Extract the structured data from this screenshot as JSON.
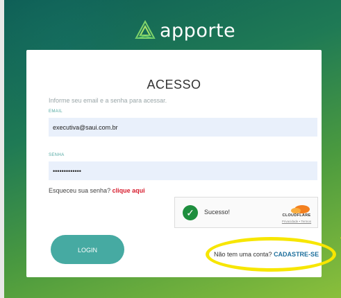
{
  "brand": {
    "name": "apporte"
  },
  "login": {
    "title": "ACESSO",
    "subtitle": "Informe seu email e a senha para acessar.",
    "email_label": "EMAIL",
    "email_value": "executiva@saui.com.br",
    "password_label": "SENHA",
    "password_value": "•••••••••••••",
    "forgot_text": "Esqueceu sua senha?",
    "forgot_link": "clique aqui",
    "captcha": {
      "status": "Sucesso!",
      "provider": "CLOUDFLARE",
      "links": "Privacidade • Termos"
    },
    "login_button": "LOGIN",
    "register_text": "Não tem uma conta?",
    "register_link": "CADASTRE-SE"
  },
  "colors": {
    "primary": "#46aaa2",
    "link_red": "#d71c2d",
    "highlight": "#f7e600",
    "field_bg": "#e9f0fb",
    "success": "#1e8e3e"
  }
}
